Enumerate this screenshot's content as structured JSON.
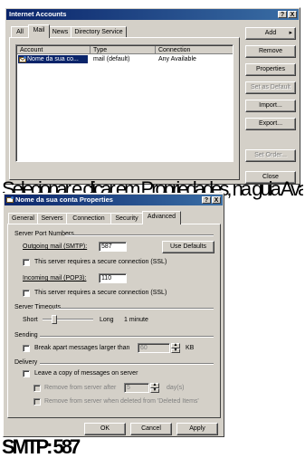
{
  "accounts_window": {
    "title": "Internet Accounts",
    "title_buttons": [
      "?",
      "X"
    ],
    "tabs": [
      "All",
      "Mail",
      "News",
      "Directory Service"
    ],
    "active_tab": "Mail",
    "columns": [
      "Account",
      "Type",
      "Connection"
    ],
    "rows": [
      {
        "account": "Nome da sua co...",
        "type": "mail (default)",
        "connection": "Any Available"
      }
    ],
    "buttons": {
      "add": "Add",
      "remove": "Remove",
      "properties": "Properties",
      "set_default": "Set as Default",
      "import": "Import...",
      "export": "Export...",
      "set_order": "Set Order...",
      "close": "Close"
    }
  },
  "overlay_text": "Selecionar e clicar em Propriedades, na guia Avançado",
  "props_dialog": {
    "title": "Nome da sua conta Properties",
    "title_buttons": [
      "?",
      "X"
    ],
    "tabs": [
      "General",
      "Servers",
      "Connection",
      "Security",
      "Advanced"
    ],
    "active_tab": "Advanced",
    "server_port_numbers": {
      "label": "Server Port Numbers",
      "outgoing_label": "Outgoing mail (SMTP):",
      "outgoing_value": "587",
      "use_defaults": "Use Defaults",
      "smtp_ssl": "This server requires a secure connection (SSL)",
      "incoming_label": "Incoming mail (POP3):",
      "incoming_value": "110",
      "pop_ssl": "This server requires a secure connection (SSL)"
    },
    "server_timeouts": {
      "label": "Server Timeouts",
      "short": "Short",
      "long": "Long",
      "value": "1 minute"
    },
    "sending": {
      "label": "Sending",
      "break_apart": "Break apart messages larger than",
      "size_value": "60",
      "unit": "KB"
    },
    "delivery": {
      "label": "Delivery",
      "leave_copy": "Leave a copy of messages on server",
      "remove_after": "Remove from server after",
      "days_value": "5",
      "days_unit": "day(s)",
      "remove_deleted": "Remove from server when deleted from 'Deleted Items'"
    },
    "footer_buttons": {
      "ok": "OK",
      "cancel": "Cancel",
      "apply": "Apply"
    }
  },
  "bottom_overlay_text": "SMTP: 587"
}
